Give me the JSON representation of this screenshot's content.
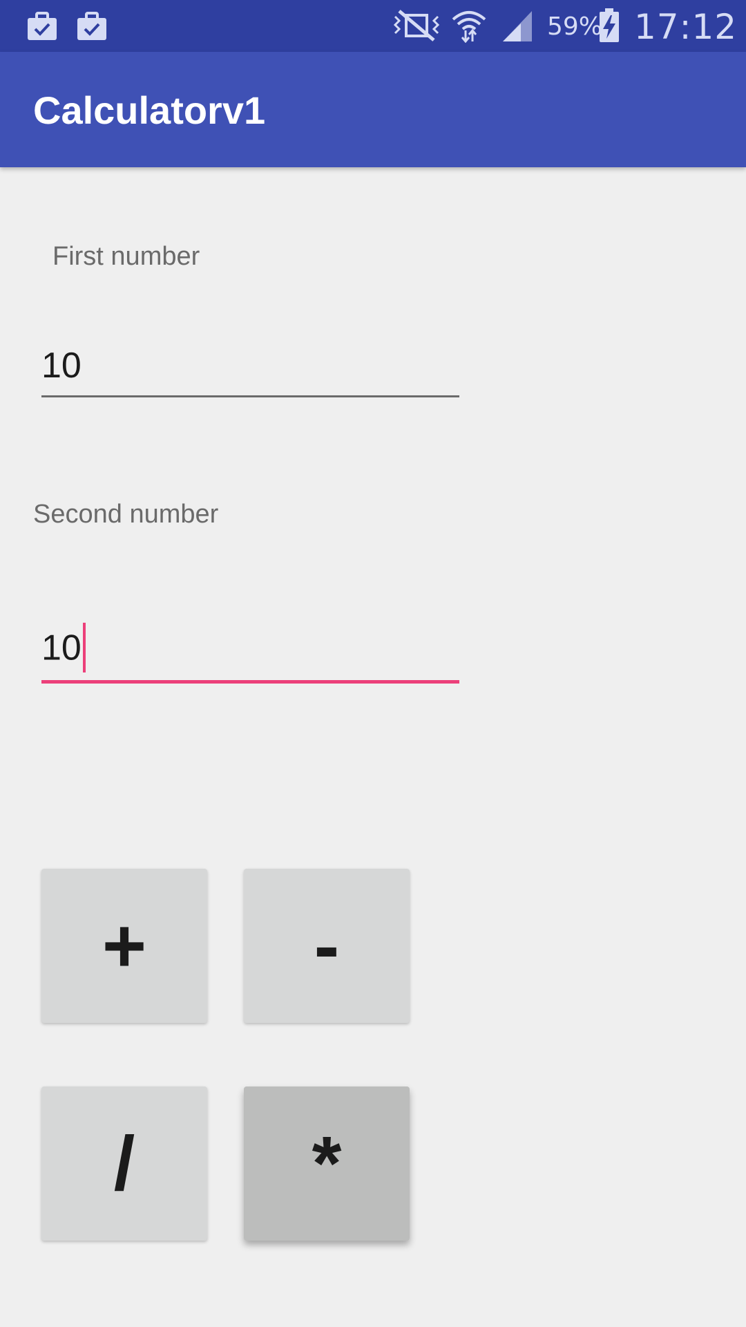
{
  "status_bar": {
    "battery_percent": "59%",
    "time": "17:12",
    "icons": [
      "briefcase-check-icon",
      "briefcase-check-icon",
      "vibrate-mute-icon",
      "wifi-icon",
      "signal-icon",
      "battery-charging-icon"
    ]
  },
  "app_bar": {
    "title": "Calculatorv1"
  },
  "form": {
    "first": {
      "label": "First number",
      "value": "10"
    },
    "second": {
      "label": "Second number",
      "value": "10"
    }
  },
  "buttons": {
    "add": "+",
    "subtract": "-",
    "divide": "/",
    "multiply": "*"
  },
  "colors": {
    "status_bar": "#2f3fa0",
    "app_bar": "#3f51b5",
    "accent": "#ec407a",
    "background": "#efefef",
    "button": "#d6d7d7",
    "button_pressed": "#bcbdbc"
  }
}
